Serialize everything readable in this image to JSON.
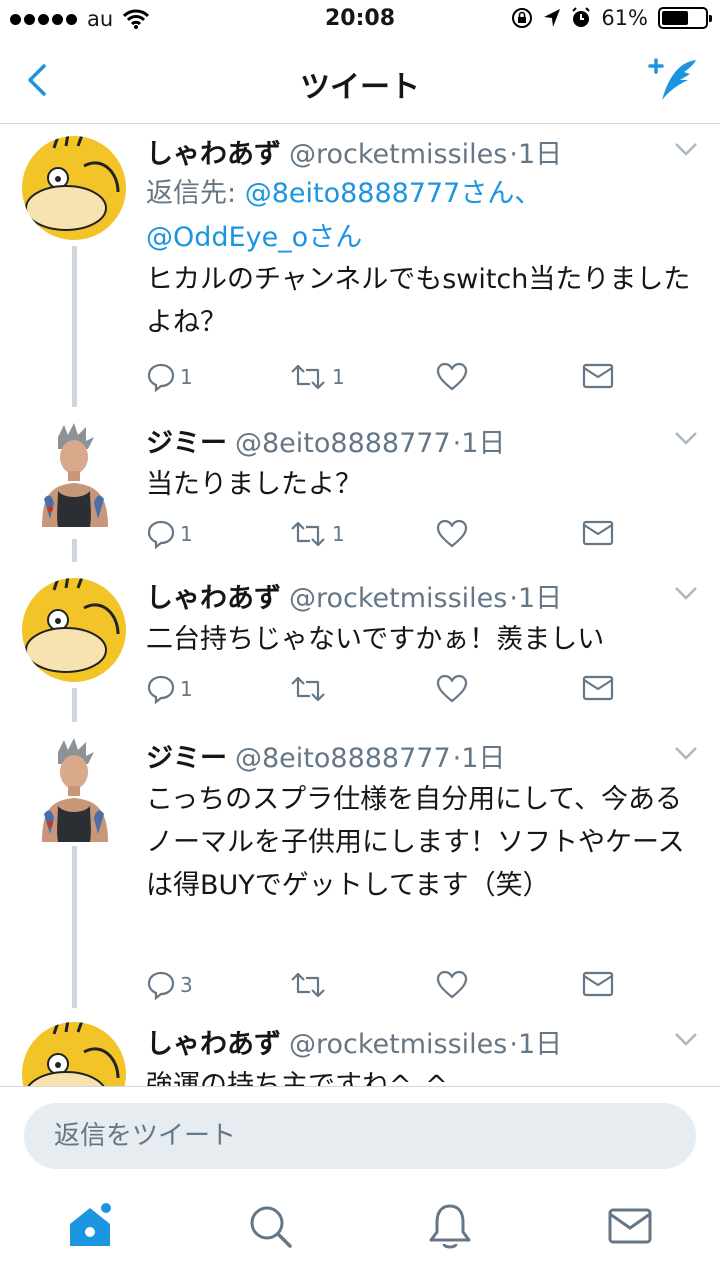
{
  "status_bar": {
    "carrier": "au",
    "time": "20:08",
    "battery": "61%",
    "battery_level": 0.61
  },
  "nav": {
    "title": "ツイート"
  },
  "tweets": [
    {
      "name": "しゃわあず",
      "handle": "@rocketmissiles",
      "time": "·1日",
      "reply_prefix": "返信先: ",
      "reply_mention_1": "@8eito8888777さん、",
      "reply_mention_2": "@OddEye_oさん",
      "body": "ヒカルのチャンネルでもswitch当たりましたよね？",
      "reply_count": "1",
      "retweet_count": "1"
    },
    {
      "name": "ジミー",
      "handle": "@8eito8888777",
      "time": "·1日",
      "body": "当たりましたよ？",
      "reply_count": "1",
      "retweet_count": "1"
    },
    {
      "name": "しゃわあず",
      "handle": "@rocketmissiles",
      "time": "·1日",
      "body": "二台持ちじゃないですかぁ！羨ましい",
      "reply_count": "1",
      "retweet_count": ""
    },
    {
      "name": "ジミー",
      "handle": "@8eito8888777",
      "time": "·1日",
      "body": "こっちのスプラ仕様を自分用にして、今あるノーマルを子供用にします！ソフトやケースは得BUYでゲットしてます（笑）",
      "reply_count": "3",
      "retweet_count": ""
    },
    {
      "name": "しゃわあず",
      "handle": "@rocketmissiles",
      "time": "·1日",
      "body": "強運の持ち主ですね^_^"
    }
  ],
  "reply_bar": {
    "placeholder": "返信をツイート"
  },
  "icons": {
    "back": "chevron-left-icon",
    "compose": "compose-tweet-icon",
    "reply": "reply-icon",
    "retweet": "retweet-icon",
    "like": "heart-icon",
    "dm": "envelope-icon",
    "home": "home-icon",
    "search": "search-icon",
    "notifications": "bell-icon",
    "messages": "envelope-icon"
  },
  "colors": {
    "accent": "#1b95e0",
    "muted": "#657786",
    "thread_line": "#cdd5de"
  }
}
